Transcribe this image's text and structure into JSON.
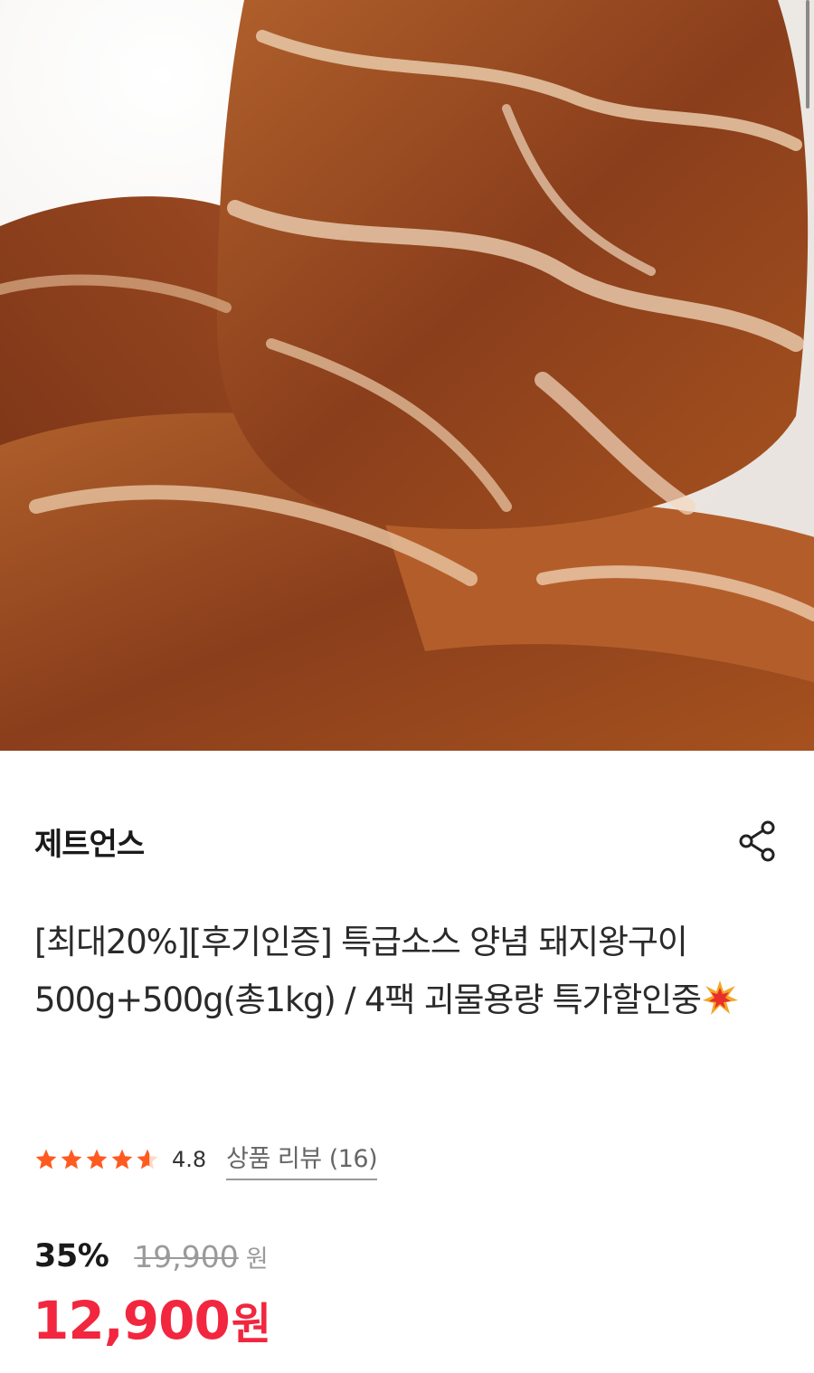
{
  "hero": {
    "image_icon": "marinated-pork-photo",
    "colors": {
      "meat": "#9a4a22",
      "fat": "#e8c7a8",
      "sauce": "#d96a1a",
      "plate": "#f2efec"
    }
  },
  "seller": {
    "name": "제트언스",
    "share_icon": "share-icon"
  },
  "product": {
    "title": "[최대20%][후기인증] 특급소스 양념 돼지왕구이 500g+500g(총1kg) / 4팩 괴물용량 특가할인중"
  },
  "rating": {
    "value": "4.8",
    "stars": 4.8,
    "review_label": "상품 리뷰 (16)"
  },
  "price": {
    "discount_rate": "35%",
    "original": "19,900",
    "original_unit": "원",
    "sale": "12,900",
    "sale_unit": "원"
  },
  "colors": {
    "accent": "#f2263f",
    "star": "#ff5a1f",
    "muted": "#9a9a9a"
  }
}
